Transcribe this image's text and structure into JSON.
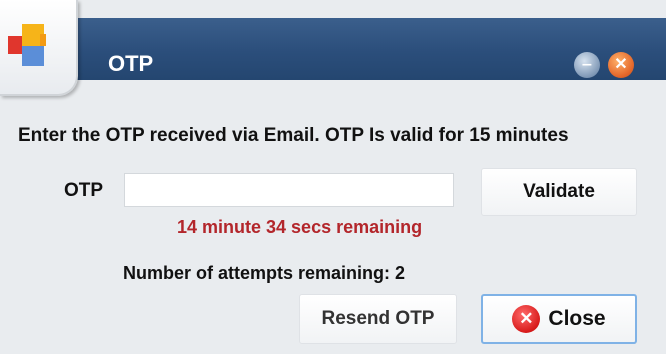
{
  "window": {
    "title": "OTP"
  },
  "titlebar_buttons": {
    "minimize_icon": "minimize-icon",
    "close_icon": "close-icon"
  },
  "dialog": {
    "instruction": "Enter the OTP received via Email. OTP Is valid for 15 minutes",
    "otp_label": "OTP",
    "otp_value": "",
    "validate_label": "Validate",
    "timer_text": "14 minute 34 secs remaining",
    "attempts_text": "Number of attempts remaining: 2",
    "resend_label": "Resend OTP",
    "close_label": "Close"
  },
  "colors": {
    "titlebar": "#2b4e7b",
    "timer_text": "#b3262b"
  }
}
